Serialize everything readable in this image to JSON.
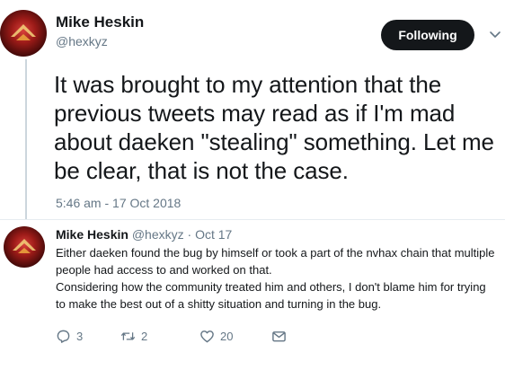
{
  "tweet": {
    "author_name": "Mike Heskin",
    "author_handle": "@hexkyz",
    "follow_label": "Following",
    "text": "It was brought to my attention that the previous tweets may read as if I'm mad about daeken \"stealing\" something. Let me be clear, that is not the case.",
    "timestamp": "5:46 am - 17 Oct 2018"
  },
  "reply": {
    "author_name": "Mike Heskin",
    "author_handle": "@hexkyz",
    "separator": "·",
    "date": "Oct 17",
    "paragraphs": [
      "Either daeken found the bug by himself or took a part of the nvhax chain that multiple people had access to and worked on that.",
      "Considering how the community treated him and others, I don't blame him for trying to make the best out of a shitty situation and turning in the bug."
    ],
    "actions": {
      "reply_count": "3",
      "retweet_count": "2",
      "like_count": "20"
    }
  },
  "icons": {
    "caret": "chevron-down-icon",
    "reply": "reply-icon",
    "retweet": "retweet-icon",
    "like": "heart-icon",
    "dm": "envelope-icon"
  },
  "colors": {
    "text": "#14171a",
    "secondary": "#657786",
    "follow_button_bg": "#14171a",
    "divider": "#e6ecf0"
  }
}
